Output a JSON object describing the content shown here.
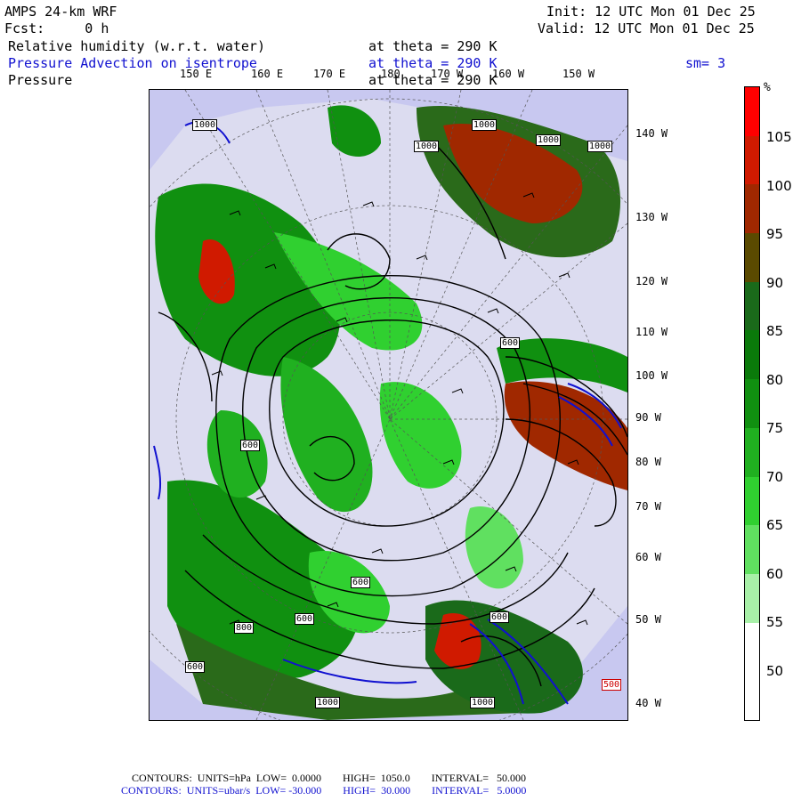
{
  "header": {
    "model": "AMPS 24-km WRF",
    "forecast": "Fcst:     0 h",
    "init": "Init: 12 UTC Mon 01 Dec 25",
    "valid": "Valid: 12 UTC Mon 01 Dec 25",
    "field1": "Relative humidity (w.r.t. water)",
    "field1_level": "at theta = 290 K",
    "field2": "Pressure Advection on isentrope",
    "field2_level": "at theta = 290 K",
    "smoothing": "sm= 3",
    "field3": "Pressure",
    "field3_level": "at theta = 290 K"
  },
  "longitude_labels_top": [
    "150 E",
    "160 E",
    "170 E",
    "180",
    "170 W",
    "160 W",
    "150 W"
  ],
  "longitude_labels_right": [
    "140 W",
    "130 W",
    "120 W",
    "110 W",
    "100 W",
    "90 W",
    "80 W",
    "70 W",
    "60 W",
    "50 W",
    "40 W"
  ],
  "contour_labels": [
    "1000",
    "1000",
    "1000",
    "1000",
    "600",
    "600",
    "600",
    "600",
    "600",
    "800",
    "1000",
    "1000",
    "600",
    "1000",
    "500"
  ],
  "colorbar": {
    "unit": "%",
    "labels": [
      "105",
      "100",
      "95",
      "90",
      "85",
      "80",
      "75",
      "70",
      "65",
      "60",
      "55",
      "50"
    ],
    "colors": [
      "#ff0000",
      "#d01a00",
      "#a02800",
      "#5a4a00",
      "#1a6a1a",
      "#0a7a0a",
      "#109010",
      "#20b020",
      "#30d030",
      "#60e060",
      "#a8f0a8",
      "#ffffff",
      "#ffffff"
    ]
  },
  "palette": {
    "ocean": "#c8c8f0",
    "land": "#dcdcf0",
    "contour": "#000000",
    "advection": "#1010d0"
  },
  "footer": {
    "line1": "CONTOURS:  UNITS=hPa  LOW=  0.0000        HIGH=  1050.0        INTERVAL=   50.000",
    "line2": "CONTOURS:  UNITS=ubar/s  LOW= -30.000        HIGH=  30.000        INTERVAL=   5.0000"
  }
}
